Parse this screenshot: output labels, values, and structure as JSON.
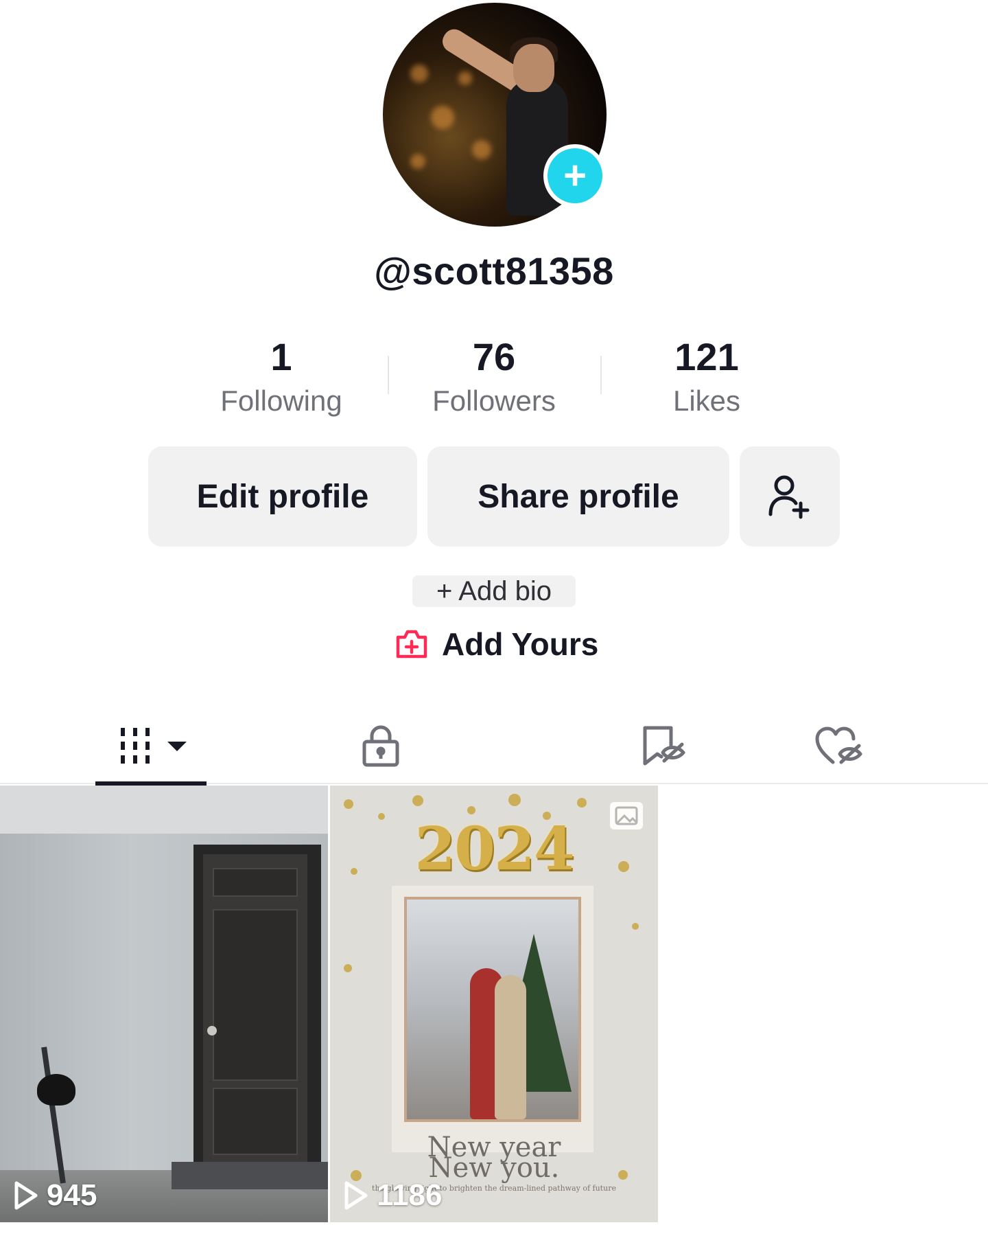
{
  "profile": {
    "username": "@scott81358",
    "add_badge": "+"
  },
  "stats": [
    {
      "value": "1",
      "label": "Following"
    },
    {
      "value": "76",
      "label": "Followers"
    },
    {
      "value": "121",
      "label": "Likes"
    }
  ],
  "actions": {
    "edit_label": "Edit profile",
    "share_label": "Share profile",
    "add_friend_icon": "add-person-icon"
  },
  "bio": {
    "add_bio_label": "+ Add bio",
    "add_yours_label": "Add Yours"
  },
  "tabs": [
    {
      "icon": "grid-icon",
      "active": true
    },
    {
      "icon": "lock-icon",
      "active": false
    },
    {
      "icon": "bookmark-hidden-icon",
      "active": false
    },
    {
      "icon": "heart-hidden-icon",
      "active": false
    }
  ],
  "videos": [
    {
      "views": "945"
    },
    {
      "views": "1186",
      "year_text": "2024",
      "caption": "New year\nNew you.",
      "tagline": "the glowing light to brighten the dream-lined pathway of future"
    }
  ],
  "colors": {
    "accent_cyan": "#20d5ec",
    "accent_pink": "#fe2c55",
    "text_primary": "#161823",
    "text_secondary": "#6f7078",
    "button_bg": "#f1f1f2"
  }
}
